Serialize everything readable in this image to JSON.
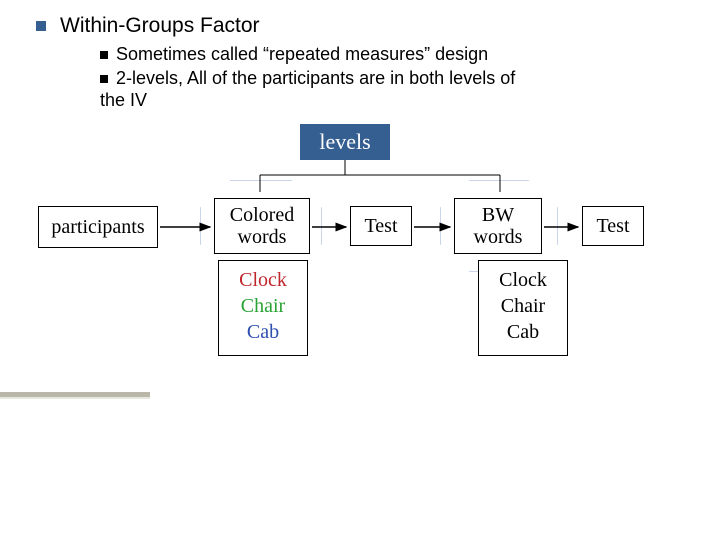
{
  "title": "Within-Groups Factor",
  "sub": {
    "a": "Sometimes called “repeated measures” design",
    "b1": "2-levels, All of the participants are in both levels of",
    "b2": "the IV"
  },
  "levels_label": "levels",
  "participants_label": "participants",
  "colored": {
    "l1": "Colored",
    "l2": "words"
  },
  "bw": {
    "l1": "BW",
    "l2": "words"
  },
  "test_label": "Test",
  "words": {
    "w1": "Clock",
    "w2": "Chair",
    "w3": "Cab"
  }
}
